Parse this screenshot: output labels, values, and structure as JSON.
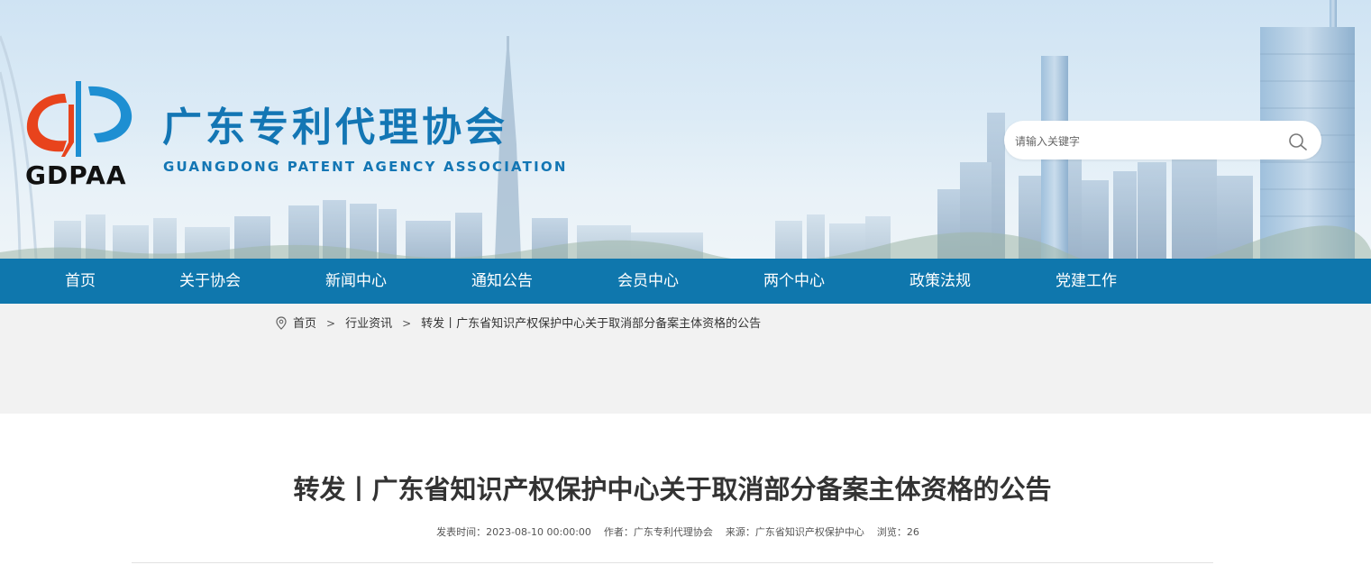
{
  "header": {
    "logo_abbr": "GDPAA",
    "site_title": "广东专利代理协会",
    "site_subtitle": "GUANGDONG PATENT AGENCY ASSOCIATION",
    "search_placeholder": "请输入关键字",
    "search_icon": "search-icon",
    "brand_blue": "#1376b4"
  },
  "nav": {
    "background": "#0f77ad",
    "items": [
      "首页",
      "关于协会",
      "新闻中心",
      "通知公告",
      "会员中心",
      "两个中心",
      "政策法规",
      "党建工作"
    ]
  },
  "breadcrumb": {
    "icon": "location-pin-icon",
    "items": [
      "首页",
      "行业资讯",
      "转发丨广东省知识产权保护中心关于取消部分备案主体资格的公告"
    ],
    "separator": ">"
  },
  "article": {
    "title": "转发丨广东省知识产权保护中心关于取消部分备案主体资格的公告",
    "meta": {
      "publish_label": "发表时间：",
      "publish_value": "2023-08-10 00:00:00",
      "author_label": "作者：",
      "author_value": "广东专利代理协会",
      "source_label": "来源：",
      "source_value": "广东省知识产权保护中心",
      "views_label": "浏览：",
      "views_value": "26"
    }
  }
}
